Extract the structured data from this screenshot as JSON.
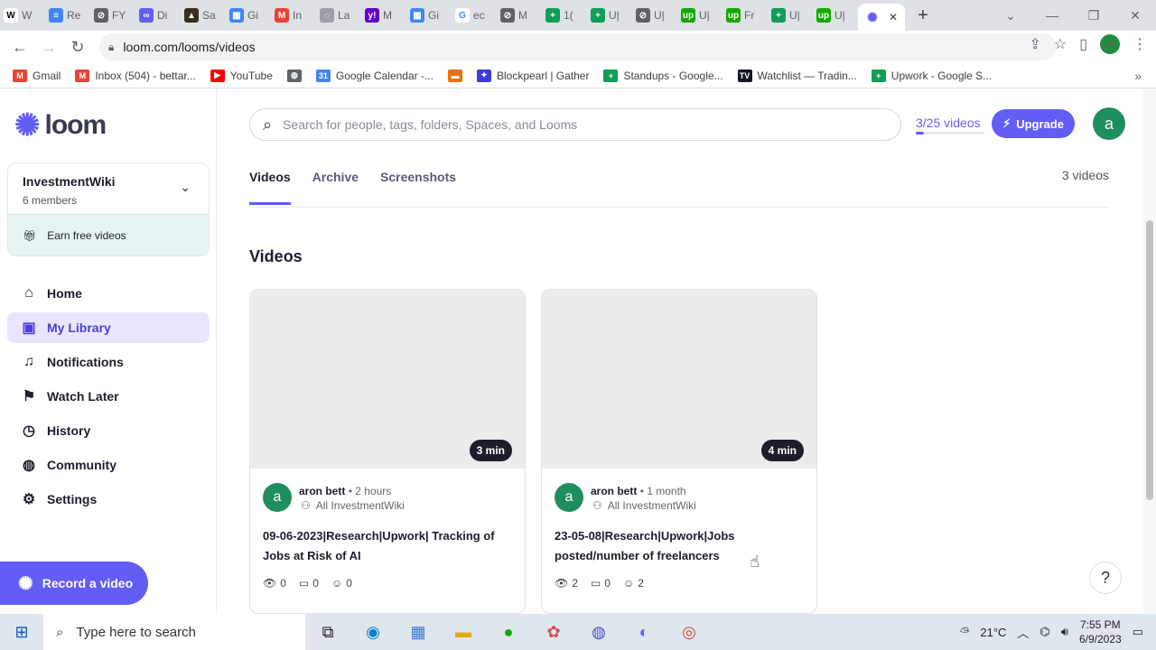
{
  "browser": {
    "tabs": [
      {
        "label": "W",
        "color": "#ffffff",
        "text_color": "#000000",
        "glyph": "W"
      },
      {
        "label": "Re",
        "color": "#4285f4",
        "text_color": "#ffffff",
        "glyph": "≡"
      },
      {
        "label": "FY",
        "color": "#5f6368",
        "text_color": "#ffffff",
        "glyph": "⊘"
      },
      {
        "label": "Di",
        "color": "#625df5",
        "text_color": "#ffffff",
        "glyph": "∞"
      },
      {
        "label": "Sa",
        "color": "#3b2f1e",
        "text_color": "#ffffff",
        "glyph": "▲"
      },
      {
        "label": "Gi",
        "color": "#4285f4",
        "text_color": "#ffffff",
        "glyph": "▦"
      },
      {
        "label": "In",
        "color": "#ea4335",
        "text_color": "#ffffff",
        "glyph": "M"
      },
      {
        "label": "La",
        "color": "#9aa0a6",
        "text_color": "#ffffff",
        "glyph": "◌"
      },
      {
        "label": "M",
        "color": "#6001d2",
        "text_color": "#ffffff",
        "glyph": "y!"
      },
      {
        "label": "Gi",
        "color": "#4285f4",
        "text_color": "#ffffff",
        "glyph": "▦"
      },
      {
        "label": "ec",
        "color": "#ffffff",
        "text_color": "#4285f4",
        "glyph": "G"
      },
      {
        "label": "M",
        "color": "#5f6368",
        "text_color": "#ffffff",
        "glyph": "⊘"
      },
      {
        "label": "1(",
        "color": "#0f9d58",
        "text_color": "#ffffff",
        "glyph": "+"
      },
      {
        "label": "U|",
        "color": "#0f9d58",
        "text_color": "#ffffff",
        "glyph": "+"
      },
      {
        "label": "U|",
        "color": "#5f6368",
        "text_color": "#ffffff",
        "glyph": "⊘"
      },
      {
        "label": "U|",
        "color": "#14a800",
        "text_color": "#ffffff",
        "glyph": "up"
      },
      {
        "label": "Fr",
        "color": "#14a800",
        "text_color": "#ffffff",
        "glyph": "up"
      },
      {
        "label": "U|",
        "color": "#0f9d58",
        "text_color": "#ffffff",
        "glyph": "+"
      },
      {
        "label": "U|",
        "color": "#14a800",
        "text_color": "#ffffff",
        "glyph": "up"
      }
    ],
    "url": "loom.com/looms/videos",
    "profile_initial": "a",
    "bookmarks": [
      {
        "label": "Gmail",
        "color": "#ea4335",
        "glyph": "M"
      },
      {
        "label": "Inbox (504) - bettar...",
        "color": "#ea4335",
        "glyph": "M"
      },
      {
        "label": "YouTube",
        "color": "#ff0000",
        "glyph": "▶"
      },
      {
        "label": "",
        "color": "#5f6368",
        "glyph": "◍"
      },
      {
        "label": "Google Calendar -...",
        "color": "#4285f4",
        "glyph": "31"
      },
      {
        "label": "",
        "color": "#e8710a",
        "glyph": "▬"
      },
      {
        "label": "Blockpearl | Gather",
        "color": "#3c3cdc",
        "glyph": "✦"
      },
      {
        "label": "Standups - Google...",
        "color": "#0f9d58",
        "glyph": "+"
      },
      {
        "label": "Watchlist — Tradin...",
        "color": "#131722",
        "glyph": "TV"
      },
      {
        "label": "Upwork - Google S...",
        "color": "#0f9d58",
        "glyph": "+"
      }
    ]
  },
  "sidebar": {
    "logo_text": "loom",
    "workspace": {
      "name": "InvestmentWiki",
      "members": "6 members",
      "earn_label": "Earn free videos"
    },
    "items": [
      {
        "label": "Home",
        "icon": "⌂"
      },
      {
        "label": "My Library",
        "icon": "▣"
      },
      {
        "label": "Notifications",
        "icon": "♫"
      },
      {
        "label": "Watch Later",
        "icon": "⚑"
      },
      {
        "label": "History",
        "icon": "◷"
      },
      {
        "label": "Community",
        "icon": "◍"
      },
      {
        "label": "Settings",
        "icon": "⚙"
      }
    ],
    "record_label": "Record a video"
  },
  "header": {
    "search_placeholder": "Search for people, tags, folders, Spaces, and Looms",
    "quota_label": "3/25 videos",
    "quota_fraction": 0.12,
    "upgrade_label": "Upgrade",
    "avatar_initial": "a"
  },
  "tabs": [
    "Videos",
    "Archive",
    "Screenshots"
  ],
  "video_count": "3 videos",
  "section_title": "Videos",
  "videos": [
    {
      "duration": "3 min",
      "author": "aron bett",
      "ago": "2 hours",
      "space": "All InvestmentWiki",
      "title": "09-06-2023|Research|Upwork| Tracking of Jobs at Risk of AI",
      "views": "0",
      "comments": "0",
      "reactions": "0"
    },
    {
      "duration": "4 min",
      "author": "aron bett",
      "ago": "1 month",
      "space": "All InvestmentWiki",
      "title": "23-05-08|Research|Upwork|Jobs posted/number of freelancers",
      "views": "2",
      "comments": "0",
      "reactions": "2"
    }
  ],
  "taskbar": {
    "search_placeholder": "Type here to search",
    "temperature": "21°C",
    "time": "7:55 PM",
    "date": "6/9/2023"
  }
}
